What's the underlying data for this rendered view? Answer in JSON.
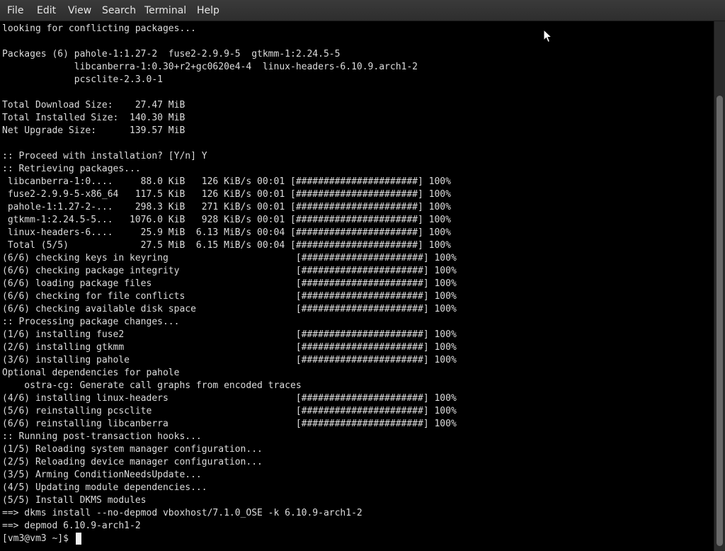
{
  "menu": {
    "items": [
      "File",
      "Edit",
      "View",
      "Search",
      "Terminal",
      "Help"
    ]
  },
  "terminal": {
    "lines": [
      "looking for conflicting packages...",
      "",
      "Packages (6) pahole-1:1.27-2  fuse2-2.9.9-5  gtkmm-1:2.24.5-5",
      "             libcanberra-1:0.30+r2+gc0620e4-4  linux-headers-6.10.9.arch1-2",
      "             pcsclite-2.3.0-1",
      "",
      "Total Download Size:    27.47 MiB",
      "Total Installed Size:  140.30 MiB",
      "Net Upgrade Size:      139.57 MiB",
      "",
      ":: Proceed with installation? [Y/n] Y",
      ":: Retrieving packages...",
      " libcanberra-1:0....     88.0 KiB   126 KiB/s 00:01 [######################] 100%",
      " fuse2-2.9.9-5-x86_64   117.5 KiB   126 KiB/s 00:01 [######################] 100%",
      " pahole-1:1.27-2-...    298.3 KiB   271 KiB/s 00:01 [######################] 100%",
      " gtkmm-1:2.24.5-5...   1076.0 KiB   928 KiB/s 00:01 [######################] 100%",
      " linux-headers-6....     25.9 MiB  6.13 MiB/s 00:04 [######################] 100%",
      " Total (5/5)             27.5 MiB  6.15 MiB/s 00:04 [######################] 100%",
      "(6/6) checking keys in keyring                       [######################] 100%",
      "(6/6) checking package integrity                     [######################] 100%",
      "(6/6) loading package files                          [######################] 100%",
      "(6/6) checking for file conflicts                    [######################] 100%",
      "(6/6) checking available disk space                  [######################] 100%",
      ":: Processing package changes...",
      "(1/6) installing fuse2                               [######################] 100%",
      "(2/6) installing gtkmm                               [######################] 100%",
      "(3/6) installing pahole                              [######################] 100%",
      "Optional dependencies for pahole",
      "    ostra-cg: Generate call graphs from encoded traces",
      "(4/6) installing linux-headers                       [######################] 100%",
      "(5/6) reinstalling pcsclite                          [######################] 100%",
      "(6/6) reinstalling libcanberra                       [######################] 100%",
      ":: Running post-transaction hooks...",
      "(1/5) Reloading system manager configuration...",
      "(2/5) Reloading device manager configuration...",
      "(3/5) Arming ConditionNeedsUpdate...",
      "(4/5) Updating module dependencies...",
      "(5/5) Install DKMS modules",
      "==> dkms install --no-depmod vboxhost/7.1.0_OSE -k 6.10.9-arch1-2",
      "==> depmod 6.10.9-arch1-2",
      "[vm3@vm3 ~]$ "
    ]
  },
  "colors": {
    "background": "#000000",
    "text": "#dcdcdc",
    "menubar": "#333333",
    "cursor": "#f2f2f2"
  }
}
